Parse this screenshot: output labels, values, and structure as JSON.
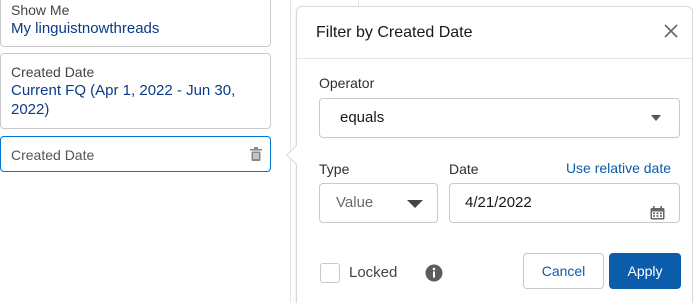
{
  "filters": {
    "show_me": {
      "label": "Show Me",
      "value": "My linguistnowthreads"
    },
    "created_date": {
      "label": "Created Date",
      "value": "Current FQ (Apr 1, 2022 - Jun 30, 2022)"
    },
    "new_filter": {
      "label": "Created Date"
    }
  },
  "popover": {
    "title": "Filter by Created Date",
    "operator": {
      "label": "Operator",
      "value": "equals"
    },
    "type": {
      "label": "Type",
      "value": "Value"
    },
    "date": {
      "label": "Date",
      "value": "4/21/2022"
    },
    "relative_link": "Use relative date",
    "locked_label": "Locked",
    "cancel_label": "Cancel",
    "apply_label": "Apply"
  },
  "colors": {
    "brand": "#0b5cab",
    "filter_value": "#0b3b86",
    "focus_border": "#0176d3"
  },
  "icons": {
    "close": "close-icon",
    "trash": "trash-icon",
    "calendar": "calendar-icon",
    "info": "info-icon",
    "caret": "chevron-down-icon"
  }
}
